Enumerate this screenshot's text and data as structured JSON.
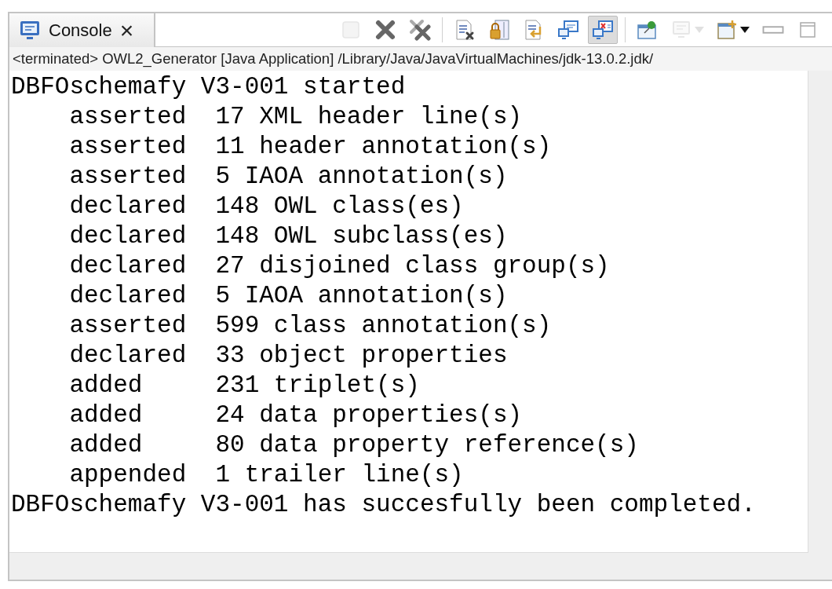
{
  "tab": {
    "title": "Console",
    "close": "×"
  },
  "toolbar": [
    {
      "kind": "stop",
      "disabled": true,
      "selected": false
    },
    {
      "kind": "remove",
      "disabled": false,
      "selected": false
    },
    {
      "kind": "remove-all",
      "disabled": false,
      "selected": false
    },
    {
      "kind": "separator"
    },
    {
      "kind": "clear",
      "disabled": false,
      "selected": false
    },
    {
      "kind": "scroll-lock",
      "disabled": false,
      "selected": false
    },
    {
      "kind": "word-wrap",
      "disabled": false,
      "selected": false
    },
    {
      "kind": "show-output",
      "disabled": false,
      "selected": false
    },
    {
      "kind": "show-error",
      "disabled": false,
      "selected": true
    },
    {
      "kind": "separator"
    },
    {
      "kind": "pin",
      "disabled": false,
      "selected": false
    },
    {
      "kind": "display",
      "disabled": true,
      "selected": false,
      "dropdown": true
    },
    {
      "kind": "new-console",
      "disabled": false,
      "selected": false,
      "dropdown": true
    },
    {
      "kind": "minimize",
      "disabled": false,
      "selected": false
    },
    {
      "kind": "maximize",
      "disabled": false,
      "selected": false
    }
  ],
  "process_label": "<terminated> OWL2_Generator [Java Application] /Library/Java/JavaVirtualMachines/jdk-13.0.2.jdk/",
  "output": [
    {
      "kind": "status",
      "text": "DBFOschemafy V3-001 started"
    },
    {
      "kind": "entry",
      "verb": "asserted",
      "detail": "17 XML header line(s)"
    },
    {
      "kind": "entry",
      "verb": "asserted",
      "detail": "11 header annotation(s)"
    },
    {
      "kind": "entry",
      "verb": "asserted",
      "detail": "5 IAOA annotation(s)"
    },
    {
      "kind": "entry",
      "verb": "declared",
      "detail": "148 OWL class(es)"
    },
    {
      "kind": "entry",
      "verb": "declared",
      "detail": "148 OWL subclass(es)"
    },
    {
      "kind": "entry",
      "verb": "declared",
      "detail": "27 disjoined class group(s)"
    },
    {
      "kind": "entry",
      "verb": "declared",
      "detail": "5 IAOA annotation(s)"
    },
    {
      "kind": "entry",
      "verb": "asserted",
      "detail": "599 class annotation(s)"
    },
    {
      "kind": "entry",
      "verb": "declared",
      "detail": "33 object properties"
    },
    {
      "kind": "entry",
      "verb": "added",
      "detail": "231 triplet(s)"
    },
    {
      "kind": "entry",
      "verb": "added",
      "detail": "24 data properties(s)"
    },
    {
      "kind": "entry",
      "verb": "added",
      "detail": "80 data property reference(s)"
    },
    {
      "kind": "entry",
      "verb": "appended",
      "detail": "1 trailer line(s)"
    },
    {
      "kind": "status",
      "text": "DBFOschemafy V3-001 has succesfully been completed."
    }
  ]
}
